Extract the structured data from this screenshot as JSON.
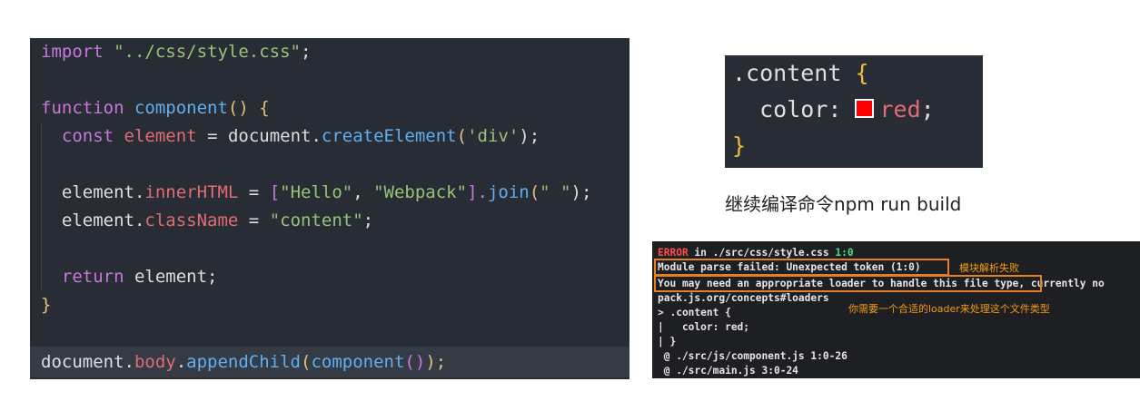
{
  "colors": {
    "keyword": "#c678dd",
    "function": "#61afef",
    "string": "#98c379",
    "variable": "#e06c75",
    "bracket": "#e5c07b",
    "plain": "#dcdfe4",
    "css_selector": "#dcdfe4",
    "css_brace": "#f5b942",
    "error_red": "#ff4d4d",
    "location_green": "#4ade80",
    "annotation_orange": "#f39c12"
  },
  "left_code": {
    "line1": {
      "kw": "import",
      "sp": " ",
      "str": "\"../css/style.css\"",
      "end": ";"
    },
    "line3": {
      "kw": "function",
      "sp": " ",
      "fn": "component",
      "parens": "()",
      "sp2": " ",
      "brace": "{"
    },
    "line4": {
      "ind": "  ",
      "kw": "const",
      "sp": " ",
      "var": "element",
      "eq": " = ",
      "obj": "document.",
      "fn": "createElement",
      "p1": "(",
      "str": "'div'",
      "p2": ");"
    },
    "line6": {
      "ind": "  ",
      "obj": "element.",
      "prop": "innerHTML",
      "eq": " = ",
      "br1": "[",
      "s1": "\"Hello\"",
      "comma": ", ",
      "s2": "\"Webpack\"",
      "br2": "].",
      "fn": "join",
      "p1": "(",
      "s3": "\" \"",
      "p2": ");"
    },
    "line7": {
      "ind": "  ",
      "obj": "element.",
      "prop": "className",
      "eq": " = ",
      "str": "\"content\"",
      "end": ";"
    },
    "line9": {
      "ind": "  ",
      "kw": "return",
      "sp": " ",
      "rest": "element;"
    },
    "line10": {
      "brace": "}"
    },
    "line12": {
      "obj": "document.",
      "prop": "body",
      "dot": ".",
      "fn": "appendChild",
      "p1": "(",
      "fn2": "component",
      "p2": "()",
      "p3": ");"
    }
  },
  "css_snippet": {
    "selector": ".content",
    "open": " {",
    "ind": "  ",
    "prop": "color",
    "colon": ": ",
    "value": "red",
    "semi": ";",
    "close": "}"
  },
  "caption": "继续编译命令npm run build",
  "terminal": {
    "l1_error": "ERROR",
    "l1_in": " in ",
    "l1_file": "./src/css/style.css",
    "l1_sp": " ",
    "l1_loc": "1:0",
    "l2": "Module parse failed: Unexpected token (1:0)",
    "l3a": "You may need an appropriate loader to handle this file type,",
    "l3b": " currently no",
    "l4": "pack.js.org/concepts#loaders",
    "l5": "> .content {",
    "l6": "|   color: red;",
    "l7": "| }",
    "l8": " @ ./src/js/component.js 1:0-26",
    "l9": " @ ./src/main.js 3:0-24",
    "anno1": "模块解析失败",
    "anno2": "你需要一个合适的loader来处理这个文件类型"
  }
}
